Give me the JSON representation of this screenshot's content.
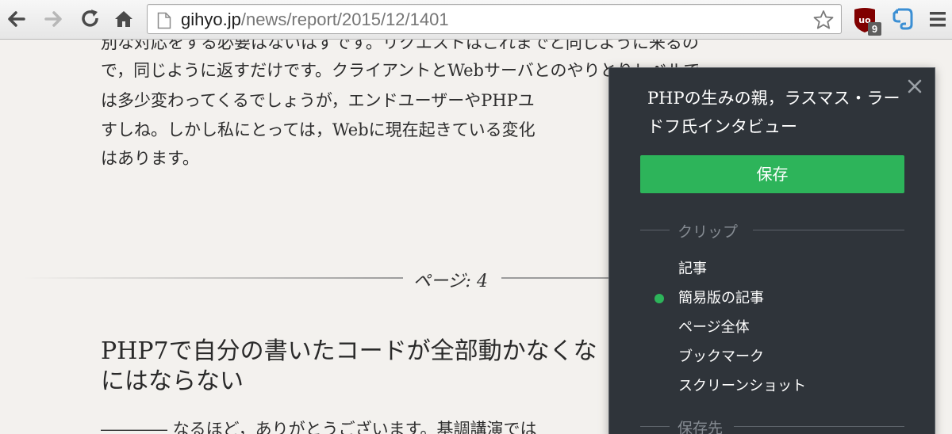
{
  "browser": {
    "url_host": "gihyo.jp",
    "url_path": "/news/report/2015/12/1401",
    "ublock_badge": "9",
    "icons": [
      "back-icon",
      "forward-icon",
      "reload-icon",
      "home-icon",
      "page-icon",
      "bookmark-star-icon",
      "ublock-icon",
      "evernote-icon",
      "menu-icon"
    ]
  },
  "article": {
    "lines": [
      "別な対応をする必要はないはずです。リクエストはこれまでと同じように来るの",
      "で，同じように返すだけです。クライアントとWebサーバとのやりとりレベルで",
      "は多少変わってくるでしょうが，エンドユーザーやPHPユ",
      "すしね。しかし私にとっては，Webに現在起きている変化",
      "はあります。"
    ],
    "page_label": "ページ: 4",
    "heading_line1": "PHP7で自分の書いたコードが全部動かなくな",
    "heading_line2": "にはならない",
    "last_line": "――――  なるほど，ありがとうございます。基調講演では"
  },
  "clipper": {
    "title": "PHPの生みの親，ラスマス・ラードフ氏インタビュー",
    "save_label": "保存",
    "clip_section": "クリップ",
    "clip_options": [
      "記事",
      "簡易版の記事",
      "ページ全体",
      "ブックマーク",
      "スクリーンショット"
    ],
    "selected_option": "簡易版の記事",
    "destination_section": "保存先",
    "accent_color": "#2db45a"
  }
}
